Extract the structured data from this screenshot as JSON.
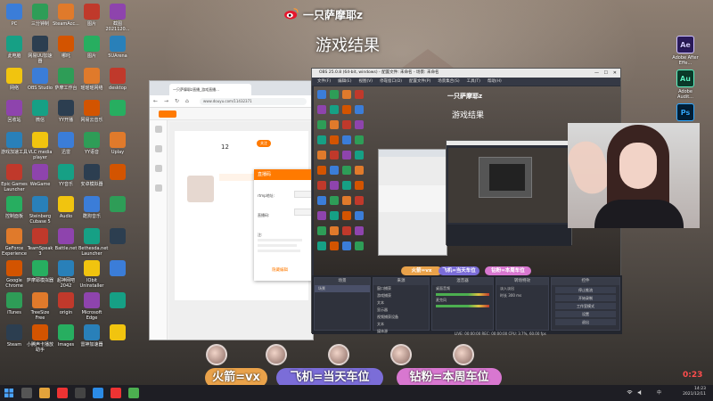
{
  "stream_overlay": {
    "streamer_name": "一只萨摩耶z",
    "screen_title": "游戏结果",
    "reward_labels": {
      "rocket": "火箭=vx",
      "plane": "飞机=当天车位",
      "fan": "钻粉=本周车位"
    },
    "timer": "0:23"
  },
  "desktop_icons_left": [
    [
      "PC",
      "三分钟制",
      "SteamAcc...",
      "图片",
      "截图 2021120..."
    ],
    [
      "此电脑",
      "网易UU加速器",
      "哪吒",
      "图片",
      "5UArena"
    ],
    [
      "网络",
      "OBS Studio",
      "萨摩工作台",
      "瑶瑶瑶网络",
      "desktop"
    ],
    [
      "回收站",
      "微信",
      "YY开播",
      "网易云音乐",
      ""
    ],
    [
      "游戏加速工具",
      "VLC media player",
      "迅雷",
      "YY语音",
      "Uplay"
    ],
    [
      "Epic Games Launcher",
      "WeGame",
      "YY音乐",
      "安卓模拟器",
      ""
    ],
    [
      "控制面板",
      "Steinberg Cubase 5",
      "Audio",
      "酷狗音乐",
      ""
    ],
    [
      "GeForce Experience",
      "TeamSpeak 3",
      "Battle.net",
      "Bethesda.net Launcher",
      ""
    ],
    [
      "Google Chrome",
      "萨摩耶模拟器",
      "超神网吧 2042",
      "IObit Uninstaller",
      ""
    ],
    [
      "iTunes",
      "TreeSize Free",
      "origin",
      "Microsoft Edge",
      ""
    ],
    [
      "Steam",
      "小腾声卡播放助手",
      "Images",
      "雷神加速器",
      ""
    ]
  ],
  "desktop_icons_right": [
    {
      "label": "Adobe After Effe...",
      "abbr": "Ae",
      "color": "#2a1a5a",
      "fg": "#cfc3ff"
    },
    {
      "label": "Adobe Audit...",
      "abbr": "Au",
      "color": "#0b3a2a",
      "fg": "#59f1c0"
    },
    {
      "label": "",
      "abbr": "Ps",
      "color": "#001e36",
      "fg": "#31a8ff"
    }
  ],
  "browser": {
    "tab_title": "一只萨摩耶z直播_游戏直播...",
    "url": "www.douyu.com/11432371",
    "card_number": "12",
    "card_text": "关注",
    "dialog": {
      "title": "直播码",
      "rows": [
        "rtmp地址:",
        "直播码:",
        "注:"
      ],
      "footer": "隐藏编辑"
    }
  },
  "obs": {
    "window_title": "OBS 25.0.8 (64-bit, windows) - 配置文件: 未命名 - 场景: 未命名",
    "menu": [
      "文件(F)",
      "编辑(E)",
      "视图(V)",
      "停靠窗口(D)",
      "配置文件(P)",
      "场景集合(S)",
      "工具(T)",
      "帮助(H)"
    ],
    "inner_streamer_name": "一只萨摩耶z",
    "inner_title": "游戏结果",
    "inner_rewards": [
      "火箭=vx",
      "飞机=当天车位",
      "钻粉=本周车位"
    ],
    "docks": {
      "scenes": {
        "title": "场景",
        "items": [
          "场景"
        ]
      },
      "sources": {
        "title": "来源",
        "items": [
          "窗口捕获",
          "游戏捕获",
          "文本",
          "显示器",
          "视频捕获设备",
          "文本",
          "媒体源"
        ]
      },
      "mixer": {
        "title": "混音器",
        "items": [
          "桌面音频",
          "麦克风"
        ]
      },
      "transitions": {
        "title": "转场特效",
        "items": [
          "淡入淡出",
          "时长 300 ms"
        ]
      },
      "controls": {
        "title": "控件",
        "buttons": [
          "停止推流",
          "开始录制",
          "工作室模式",
          "设置",
          "退出"
        ]
      }
    },
    "status": "LIVE: 00:00:00  REC: 00:00:00  CPU: 3.7%, 60.00 fps"
  },
  "taskbar": {
    "clock": "14:23",
    "date": "2021/12/11"
  },
  "colors": {
    "accent_orange": "#ff7a00",
    "obs_bg": "#2b2e38",
    "rocket": "#e9a24a",
    "plane": "#7b6dd8",
    "fan": "#d877d0",
    "timer": "#ff4d4d"
  }
}
